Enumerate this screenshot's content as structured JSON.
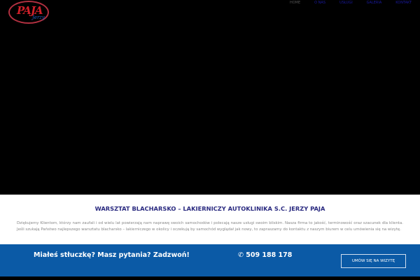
{
  "logo": {
    "main": "PAJA",
    "sub": "Jerzy"
  },
  "nav": [
    "HOME",
    "O NAS",
    "USŁUGI",
    "GALERIA",
    "KONTAKT"
  ],
  "about": {
    "title": "WARSZTAT BLACHARSKO – LAKIERNICZY AUTOKLINIKA S.C. JERZY PAJA",
    "text": "Dziękujemy Klientom, którzy nam zaufali i od wielu lat powierzają nam naprawę swoich samochodów i polecają nasze usługi swoim bliskim. Nasza firma to jakość, terminowość oraz szacunek dla klienta. Jeśli szukają Państwo najlepszego warsztatu blacharsko – lakierniczego w okolicy i oczekują by samochód wyglądał jak nowy, to zapraszamy do kontaktu z naszym biurem w celu umówienia się na wizytę."
  },
  "cta": {
    "question": "Miałeś stłuczkę? Masz pytania? Zadzwoń!",
    "phone_icon": "✆",
    "phone": "509 188 178",
    "button": "UMÓW SIĘ NA WIZYTĘ"
  }
}
